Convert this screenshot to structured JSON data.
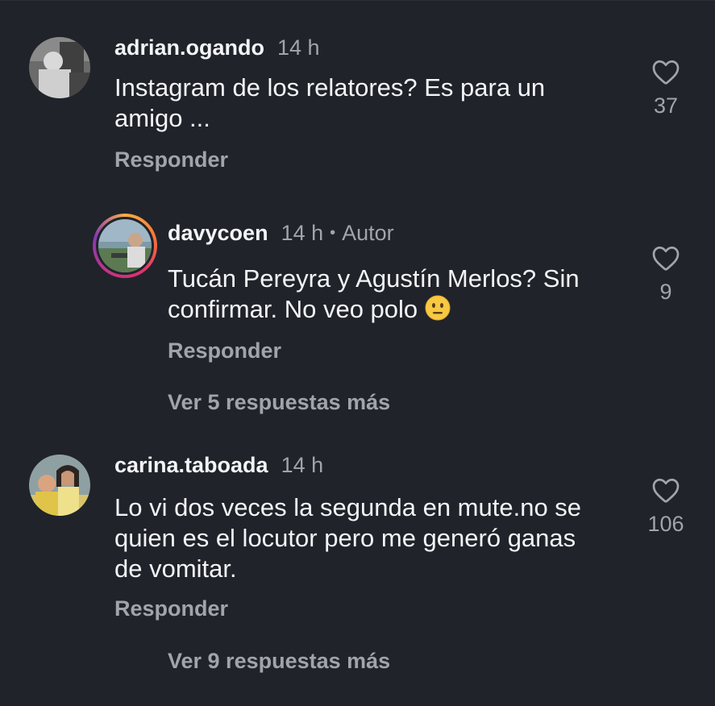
{
  "comments": [
    {
      "username": "adrian.ogando",
      "time": "14 h",
      "text_line1": "Instagram de los relatores? Es para un",
      "text_line2": "amigo ...",
      "reply_label": "Responder",
      "likes": "37",
      "avatar_icon": "profile-photo-bw"
    },
    {
      "username": "davycoen",
      "time": "14 h",
      "author_badge": "Autor",
      "text_line1": "Tucán Pereyra y Agustín Merlos? Sin",
      "text_line2": "confirmar. No veo polo",
      "emoji": "neutral-face-emoji",
      "reply_label": "Responder",
      "likes": "9",
      "more_replies": "Ver 5 respuestas más",
      "avatar_icon": "profile-photo-story-ring"
    },
    {
      "username": "carina.taboada",
      "time": "14 h",
      "text_line1": "Lo vi dos veces la segunda en mute.no se",
      "text_line2": "quien es el locutor pero me generó ganas",
      "text_line3": "de vomitar.",
      "reply_label": "Responder",
      "likes": "106",
      "more_replies": "Ver 9 respuestas más",
      "avatar_icon": "profile-photo-color"
    }
  ],
  "colors": {
    "background": "#20232a",
    "primary_text": "#f3f4f6",
    "secondary_text": "#a1a4ab"
  },
  "icons": {
    "like": "heart-outline-icon"
  }
}
